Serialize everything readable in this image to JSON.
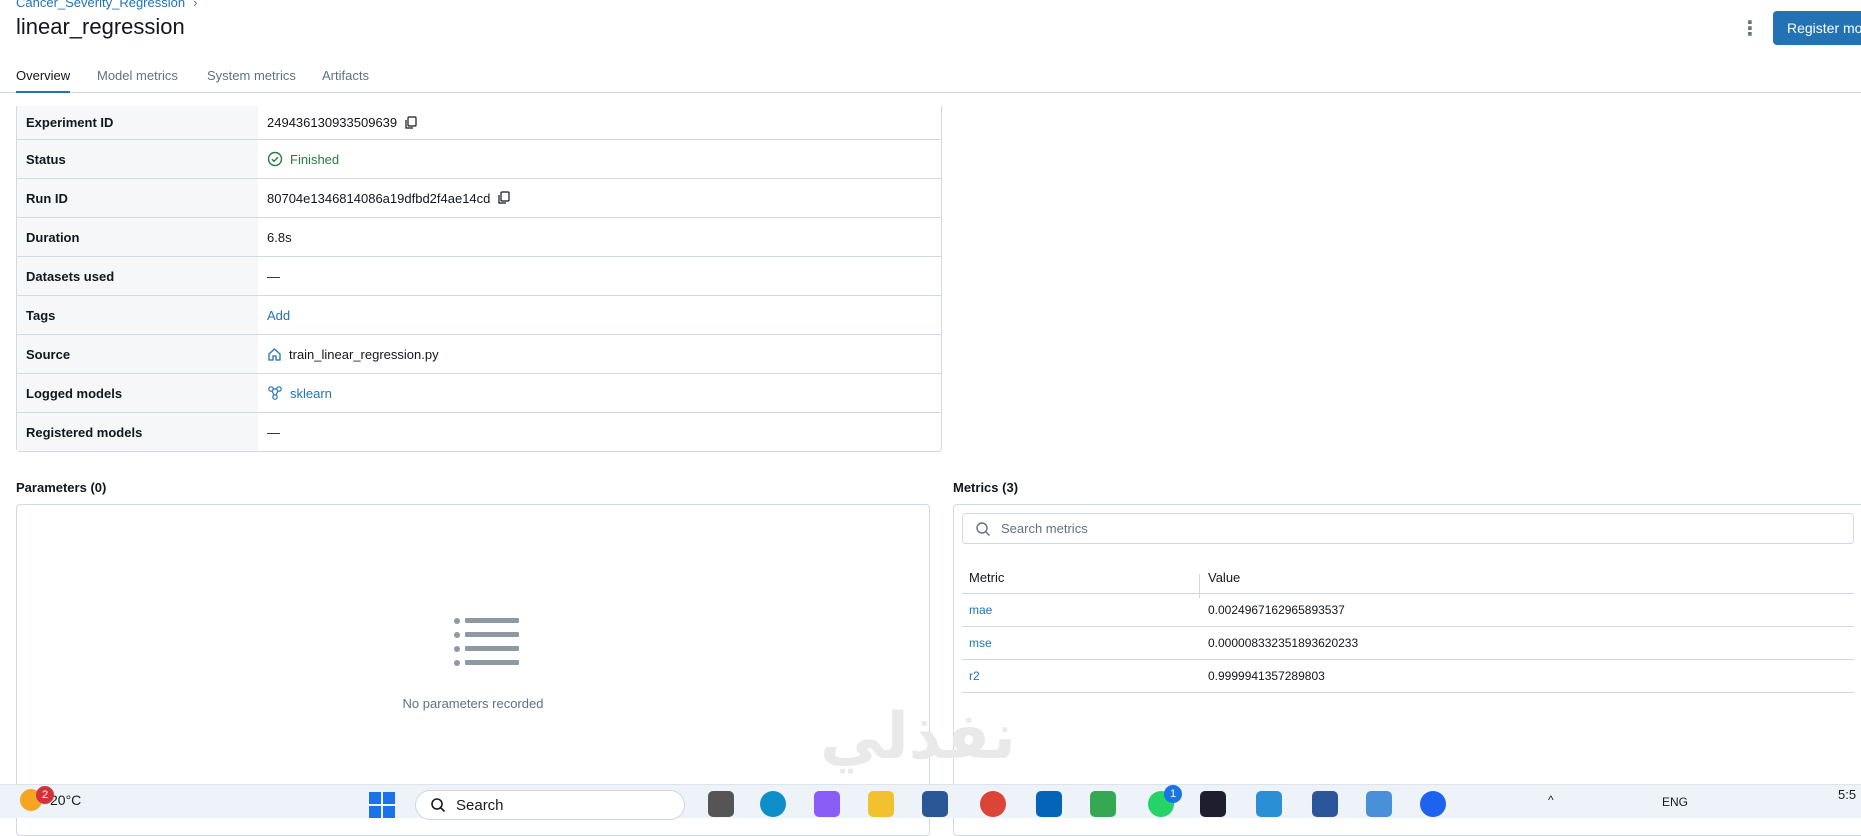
{
  "breadcrumb": {
    "experiment": "Cancer_Severity_Regression",
    "separator": "›"
  },
  "page_title": "linear_regression",
  "header": {
    "more_icon": "kebab-icon",
    "register_label": "Register model"
  },
  "tabs": [
    {
      "label": "Overview",
      "active": true
    },
    {
      "label": "Model metrics",
      "active": false
    },
    {
      "label": "System metrics",
      "active": false
    },
    {
      "label": "Artifacts",
      "active": false
    }
  ],
  "details": {
    "experiment_id": {
      "label": "Experiment ID",
      "value": "249436130933509639",
      "icon": "copy-icon"
    },
    "status": {
      "label": "Status",
      "value": "Finished",
      "icon": "check-circle-icon"
    },
    "run_id": {
      "label": "Run ID",
      "value": "80704e1346814086a19dfbd2f4ae14cd",
      "icon": "copy-icon"
    },
    "duration": {
      "label": "Duration",
      "value": "6.8s"
    },
    "datasets": {
      "label": "Datasets used",
      "value": "—"
    },
    "tags": {
      "label": "Tags",
      "value": "Add"
    },
    "source": {
      "label": "Source",
      "value": "train_linear_regression.py",
      "icon": "home-icon"
    },
    "logged_models": {
      "label": "Logged models",
      "value": "sklearn",
      "icon": "model-icon"
    },
    "registered_models": {
      "label": "Registered models",
      "value": "—"
    }
  },
  "parameters": {
    "title": "Parameters (0)",
    "empty_text": "No parameters recorded"
  },
  "metrics": {
    "title": "Metrics (3)",
    "search_placeholder": "Search metrics",
    "columns": [
      "Metric",
      "Value"
    ],
    "rows": [
      {
        "name": "mae",
        "value": "0.0024967162965893537"
      },
      {
        "name": "mse",
        "value": "0.000008332351893620233"
      },
      {
        "name": "r2",
        "value": "0.9999941357289803"
      }
    ]
  },
  "watermark": "نفذلي",
  "taskbar": {
    "weather_badge": "2",
    "temperature": "20°C",
    "search_label": "Search",
    "whatsapp_badge": "1",
    "language": "ENG",
    "clock": "5:5"
  },
  "colors": {
    "accent": "#2272b4",
    "success": "#277c43",
    "border": "#d1d9e1",
    "label_bg": "#f6f7f9"
  }
}
